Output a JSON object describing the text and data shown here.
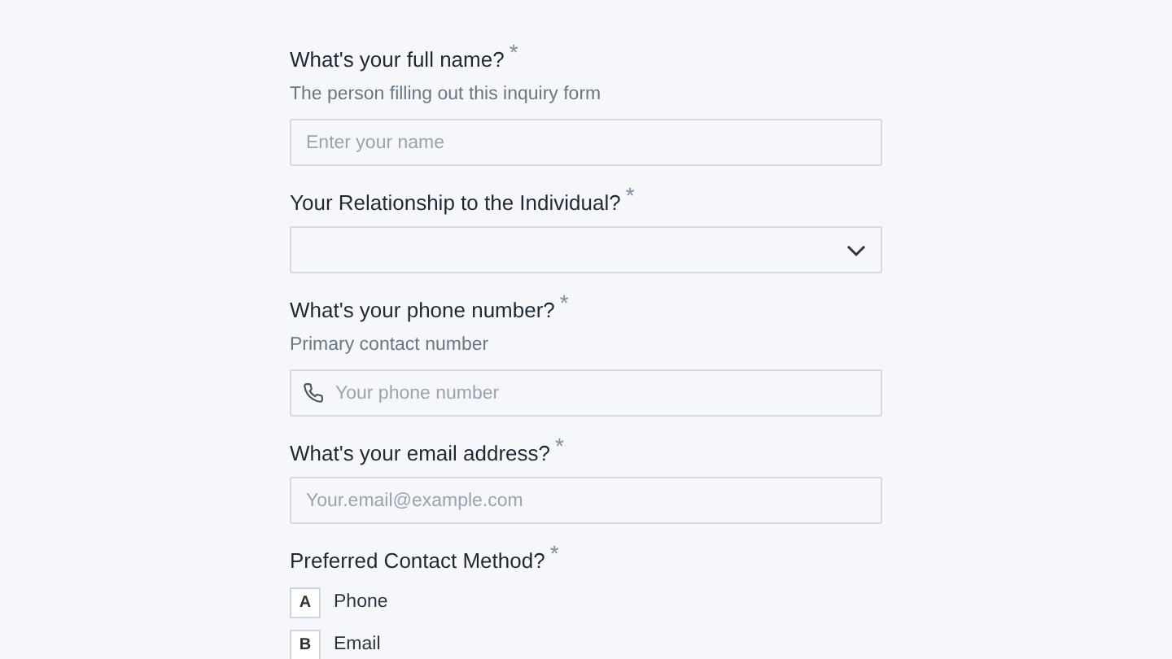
{
  "questions": [
    {
      "kind": "text",
      "label": "What's your full name?",
      "required_mark": "*",
      "hint": "The person filling out this inquiry form",
      "placeholder": "Enter your name"
    },
    {
      "kind": "select",
      "label": "Your Relationship to the Individual?",
      "required_mark": "*"
    },
    {
      "kind": "phone",
      "label": "What's your phone number?",
      "required_mark": "*",
      "hint": "Primary contact number",
      "placeholder": "Your phone number"
    },
    {
      "kind": "text",
      "label": "What's your email address?",
      "required_mark": "*",
      "placeholder": "Your.email@example.com"
    },
    {
      "kind": "choice",
      "label": "Preferred Contact Method?",
      "required_mark": "*",
      "options": [
        {
          "key": "A",
          "label": "Phone",
          "selected": false
        },
        {
          "key": "B",
          "label": "Email",
          "selected": false
        }
      ]
    }
  ]
}
